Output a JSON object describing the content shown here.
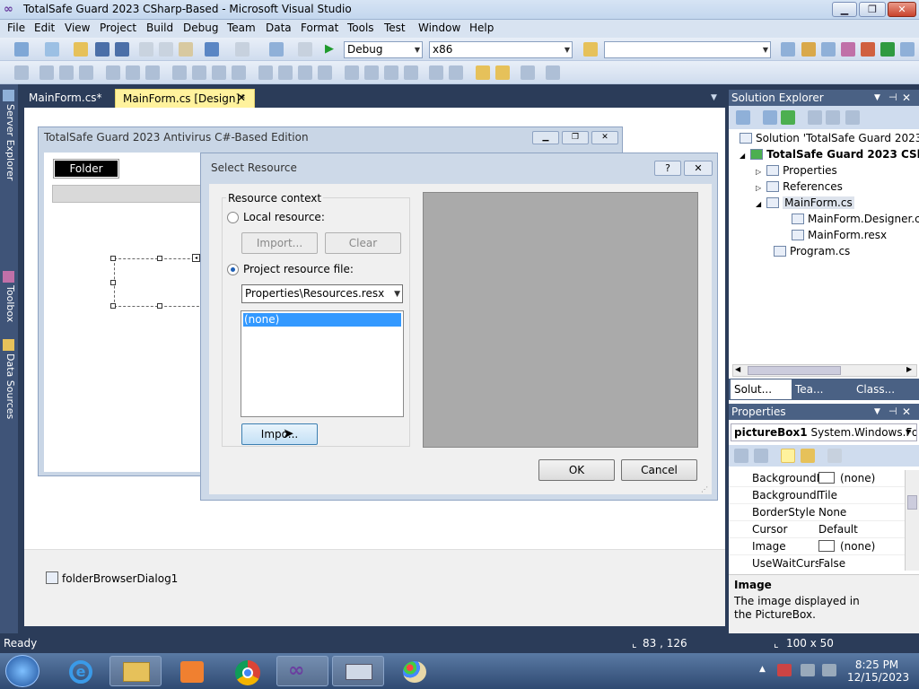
{
  "window": {
    "title": "TotalSafe Guard 2023 CSharp-Based - Microsoft Visual Studio"
  },
  "menu": [
    "File",
    "Edit",
    "View",
    "Project",
    "Build",
    "Debug",
    "Team",
    "Data",
    "Format",
    "Tools",
    "Test",
    "Window",
    "Help"
  ],
  "toolbar": {
    "config": "Debug",
    "platform": "x86"
  },
  "left_tabs": [
    "Server Explorer",
    "Toolbox",
    "Data Sources"
  ],
  "doc_tabs": [
    {
      "label": "MainForm.cs*"
    },
    {
      "label": "MainForm.cs [Design]*"
    }
  ],
  "form": {
    "title": "TotalSafe Guard 2023 Antivirus C#-Based Edition",
    "folder_button": "Folder"
  },
  "dialog": {
    "title": "Select Resource",
    "help": "?",
    "group": "Resource context",
    "local_label": "Local resource:",
    "import1": "Import...",
    "clear": "Clear",
    "project_label": "Project resource file:",
    "resx_value": "Properties\\Resources.resx",
    "list_item": "(none)",
    "import2": "Impo...",
    "ok": "OK",
    "cancel": "Cancel"
  },
  "tray": {
    "item": "folderBrowserDialog1"
  },
  "solution_explorer": {
    "title": "Solution Explorer",
    "nodes": [
      "Solution 'TotalSafe Guard 2023 C",
      "TotalSafe Guard 2023 CShar",
      "Properties",
      "References",
      "MainForm.cs",
      "MainForm.Designer.cs",
      "MainForm.resx",
      "Program.cs"
    ],
    "tabs": [
      "Solut...",
      "Tea...",
      "Class..."
    ]
  },
  "properties": {
    "title": "Properties",
    "object": "pictureBox1",
    "object_type": "System.Windows.For",
    "rows": [
      {
        "name": "BackgroundIr",
        "value": "(none)"
      },
      {
        "name": "BackgroundIr",
        "value": "Tile"
      },
      {
        "name": "BorderStyle",
        "value": "None"
      },
      {
        "name": "Cursor",
        "value": "Default"
      },
      {
        "name": "Image",
        "value": "(none)"
      },
      {
        "name": "UseWaitCursc",
        "value": "False"
      }
    ],
    "desc_title": "Image",
    "desc_text": "The image displayed in the PictureBox."
  },
  "status": {
    "text": "Ready",
    "coords": "83 , 126",
    "size": "100 x 50"
  },
  "clock": {
    "time": "8:25 PM",
    "date": "12/15/2023"
  },
  "colors": {
    "accent": "#2b3c59",
    "selection": "#3399ff",
    "tab_active": "#fff29d"
  }
}
